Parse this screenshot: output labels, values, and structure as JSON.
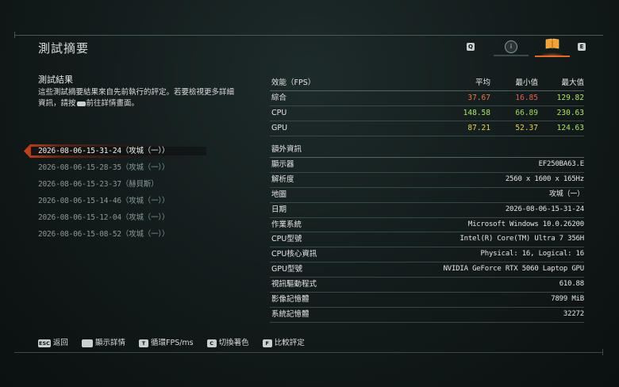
{
  "header": {
    "title": "測試摘要",
    "tabs": [
      {
        "key": "Q",
        "name": "prev"
      },
      {
        "name": "info-tab",
        "icon": "info-icon"
      },
      {
        "name": "summary-tab",
        "icon": "book-icon",
        "active": true
      },
      {
        "key": "E",
        "name": "next"
      }
    ]
  },
  "left": {
    "section_title": "測試結果",
    "description_1": "這些測試摘要結果來自先前執行的評定。若要檢視更多詳細資訊，請按",
    "description_2": "前往詳情畫面。",
    "history": [
      {
        "label": "2026-08-06-15-31-24（攻城（一））",
        "selected": true
      },
      {
        "label": "2026-08-06-15-28-35（攻城（一））",
        "selected": false
      },
      {
        "label": "2026-08-06-15-23-37（赫貝斯）",
        "selected": false
      },
      {
        "label": "2026-08-06-15-14-46（攻城（一））",
        "selected": false
      },
      {
        "label": "2026-08-06-15-12-04（攻城（一））",
        "selected": false
      },
      {
        "label": "2026-08-06-15-08-52（攻城（一））",
        "selected": false
      }
    ]
  },
  "perf": {
    "headers": {
      "label": "效能（FPS）",
      "avg": "平均",
      "min": "最小值",
      "max": "最大值"
    },
    "rows": [
      {
        "label": "綜合",
        "avg": "37.67",
        "min": "16.85",
        "max": "129.82"
      },
      {
        "label": "CPU",
        "avg": "148.58",
        "min": "66.89",
        "max": "230.63"
      },
      {
        "label": "GPU",
        "avg": "87.21",
        "min": "52.37",
        "max": "124.63"
      }
    ]
  },
  "extra": {
    "title": "額外資訊",
    "rows": [
      {
        "key": "顯示器",
        "value": "EF250BA63.E"
      },
      {
        "key": "解析度",
        "value": "2560 x 1600 x 165Hz"
      },
      {
        "key": "地圖",
        "value": "攻城（一）"
      },
      {
        "key": "日期",
        "value": "2026-08-06-15-31-24"
      },
      {
        "key": "作業系統",
        "value": "Microsoft Windows 10.0.26200"
      },
      {
        "key": "CPU型號",
        "value": "Intel(R) Core(TM) Ultra 7 356H"
      },
      {
        "key": "CPU核心資訊",
        "value": "Physical: 16, Logical: 16"
      },
      {
        "key": "GPU型號",
        "value": "NVIDIA GeForce RTX 5060 Laptop GPU"
      },
      {
        "key": "視訊驅動程式",
        "value": "610.88"
      },
      {
        "key": "影像記憶體",
        "value": "7899 MiB"
      },
      {
        "key": "系統記憶體",
        "value": "32272"
      }
    ]
  },
  "footer": {
    "items": [
      {
        "key": "ESC",
        "label": "返回"
      },
      {
        "key": "",
        "label": "顯示詳情"
      },
      {
        "key": "T",
        "label": "循環FPS/ms"
      },
      {
        "key": "C",
        "label": "切換著色"
      },
      {
        "key": "F",
        "label": "比較評定"
      }
    ]
  },
  "colors": {
    "accent": "#e06a24",
    "red": "#e0605a",
    "green": "#a6d860",
    "yellow": "#e7d05a"
  }
}
